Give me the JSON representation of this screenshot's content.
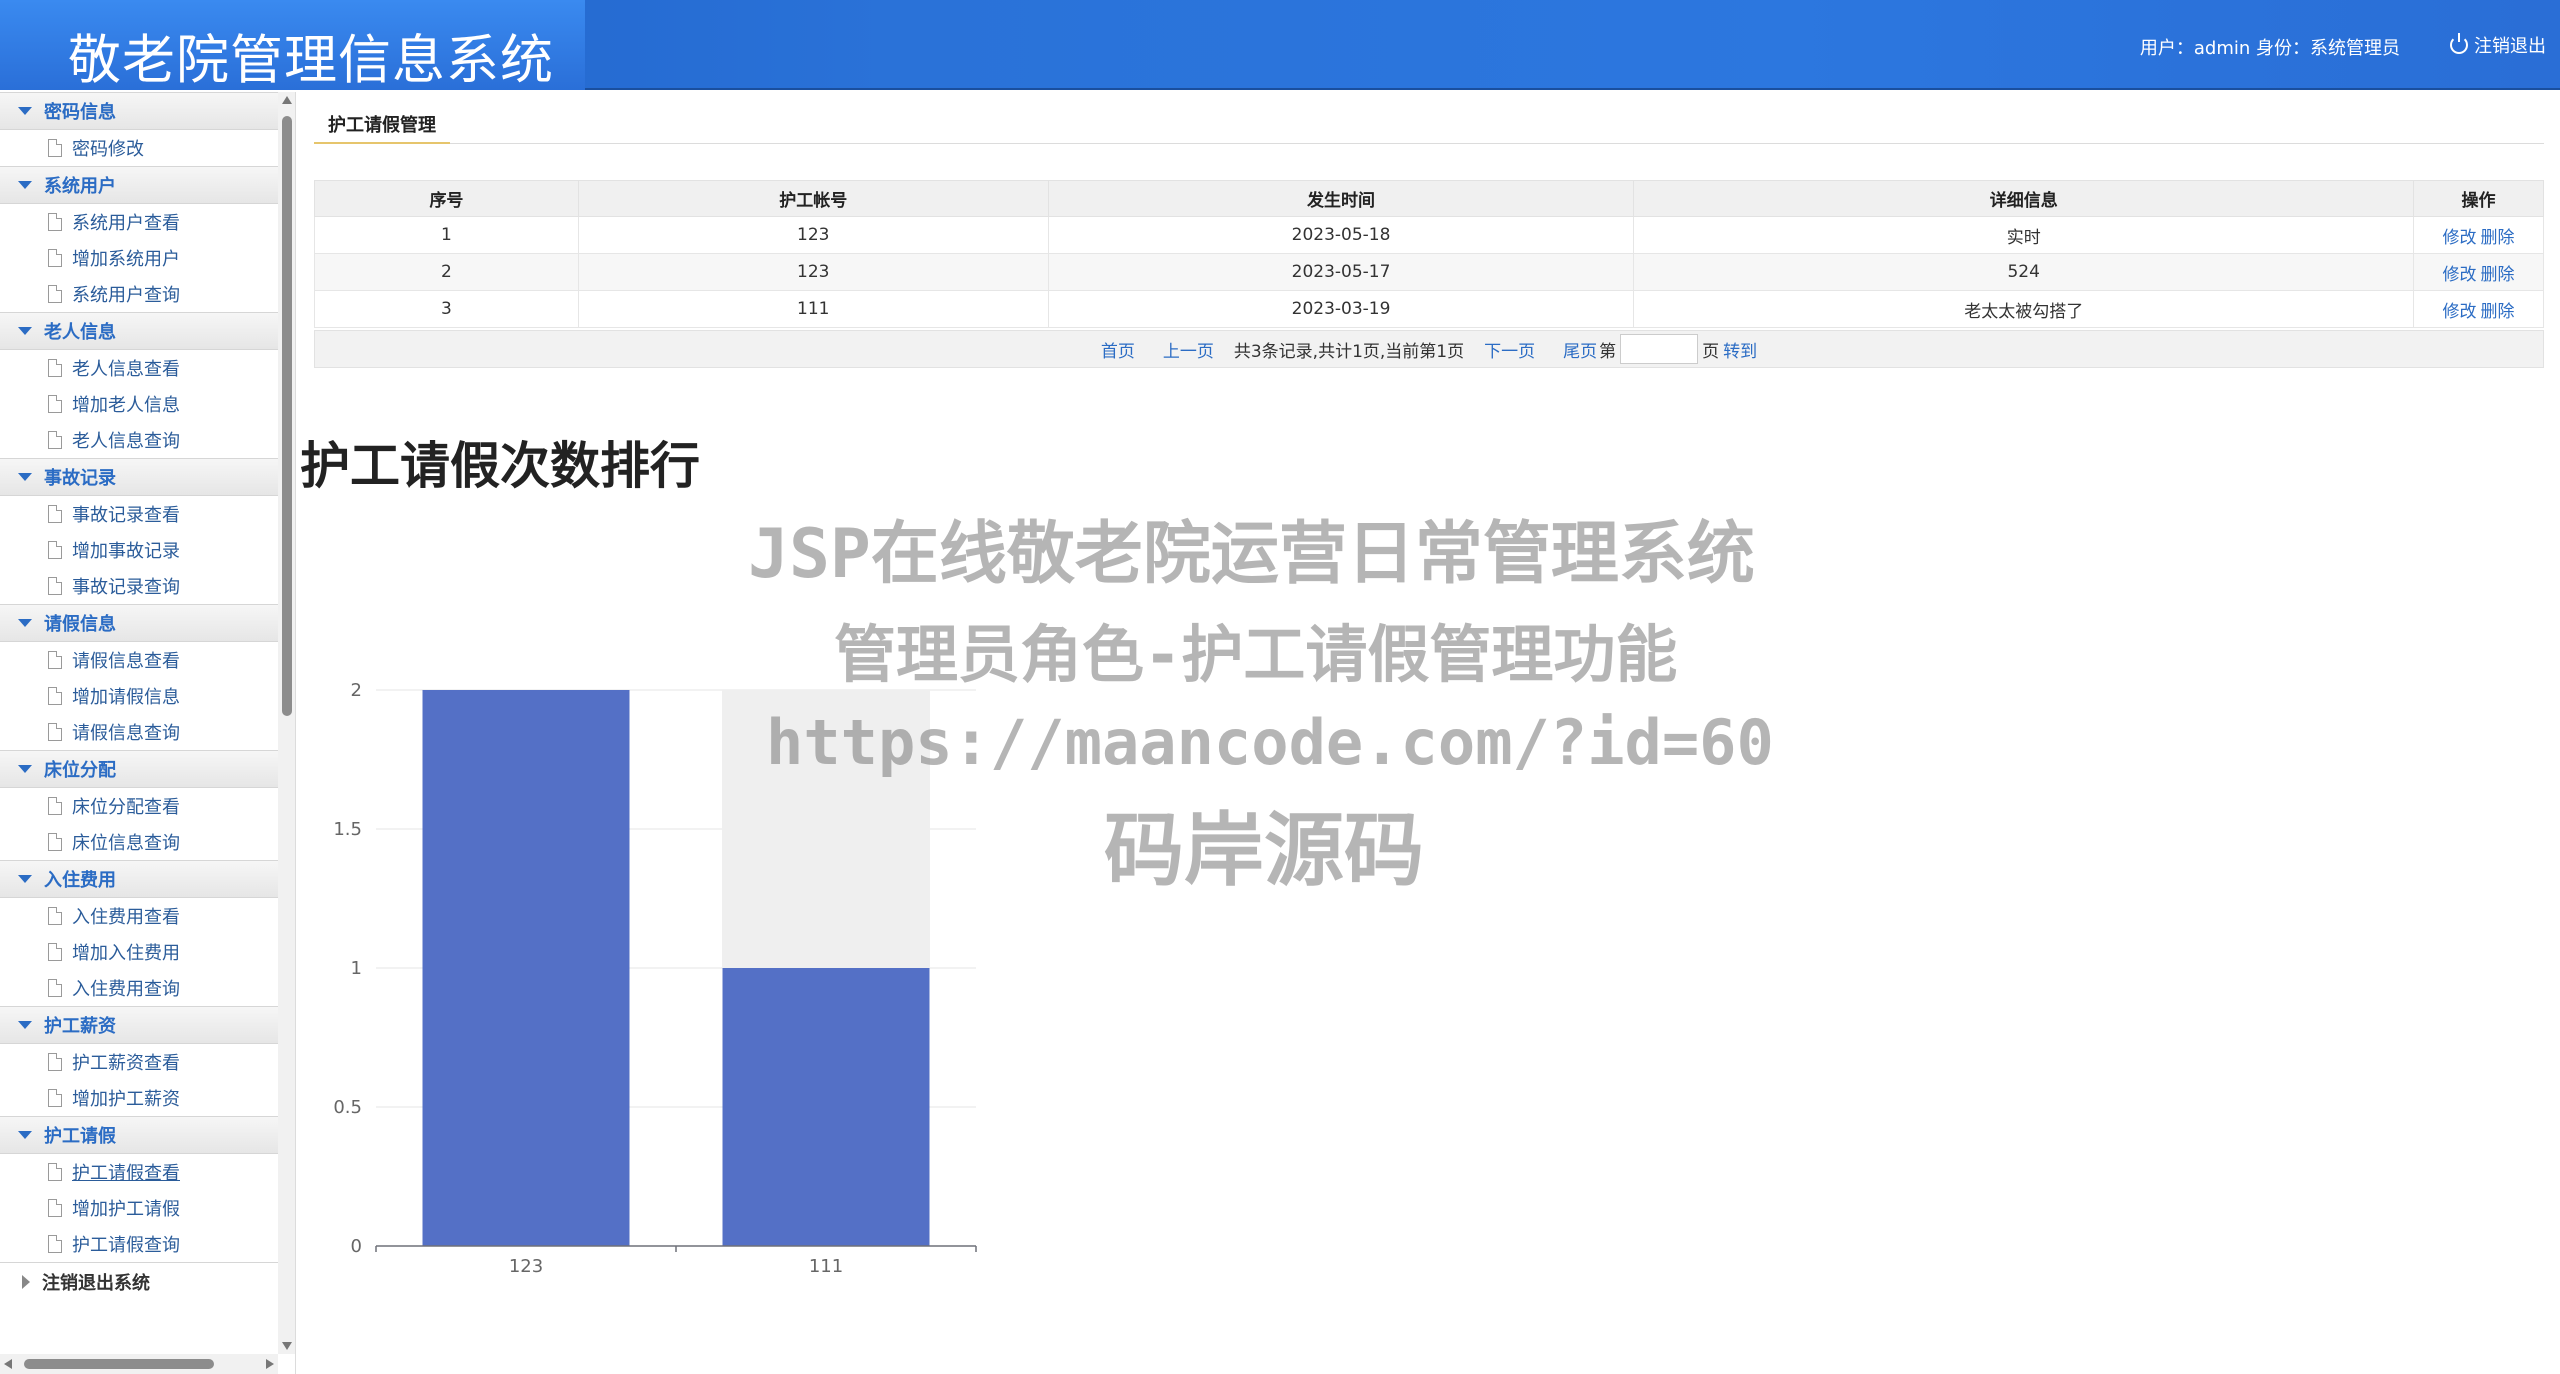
{
  "header": {
    "title": "敬老院管理信息系统",
    "user_info": "用户：admin 身份：系统管理员",
    "logout_label": "注销退出"
  },
  "sidebar": {
    "groups": [
      {
        "label": "密码信息",
        "items": [
          "密码修改"
        ]
      },
      {
        "label": "系统用户",
        "items": [
          "系统用户查看",
          "增加系统用户",
          "系统用户查询"
        ]
      },
      {
        "label": "老人信息",
        "items": [
          "老人信息查看",
          "增加老人信息",
          "老人信息查询"
        ]
      },
      {
        "label": "事故记录",
        "items": [
          "事故记录查看",
          "增加事故记录",
          "事故记录查询"
        ]
      },
      {
        "label": "请假信息",
        "items": [
          "请假信息查看",
          "增加请假信息",
          "请假信息查询"
        ]
      },
      {
        "label": "床位分配",
        "items": [
          "床位分配查看",
          "床位信息查询"
        ]
      },
      {
        "label": "入住费用",
        "items": [
          "入住费用查看",
          "增加入住费用",
          "入住费用查询"
        ]
      },
      {
        "label": "护工薪资",
        "items": [
          "护工薪资查看",
          "增加护工薪资"
        ]
      },
      {
        "label": "护工请假",
        "items": [
          "护工请假查看",
          "增加护工请假",
          "护工请假查询"
        ]
      }
    ],
    "exit_label": "注销退出系统"
  },
  "main": {
    "tab_label": "护工请假管理",
    "table": {
      "columns": [
        "序号",
        "护工帐号",
        "发生时间",
        "详细信息",
        "操作"
      ],
      "rows": [
        {
          "no": "1",
          "account": "123",
          "date": "2023-05-18",
          "detail": "实时"
        },
        {
          "no": "2",
          "account": "123",
          "date": "2023-05-17",
          "detail": "524"
        },
        {
          "no": "3",
          "account": "111",
          "date": "2023-03-19",
          "detail": "老太太被勾搭了"
        }
      ],
      "edit_label": "修改",
      "delete_label": "删除"
    },
    "pager": {
      "first": "首页",
      "prev": "上一页",
      "info": "共3条记录,共计1页,当前第1页",
      "next": "下一页",
      "last": "尾页",
      "page_prefix": "第",
      "page_suffix": "页",
      "goto": "转到"
    },
    "chart_title": "护工请假次数排行"
  },
  "chart_data": {
    "type": "bar",
    "categories": [
      "123",
      "111"
    ],
    "values": [
      2,
      1
    ],
    "ylim": [
      0,
      2
    ],
    "yticks": [
      "0",
      "0.5",
      "1",
      "1.5",
      "2"
    ],
    "bar_color": "#5470c6",
    "grid": true
  },
  "watermark": {
    "line1": "JSP在线敬老院运营日常管理系统",
    "line2": "管理员角色-护工请假管理功能",
    "line3": "https://maancode.com/?id=60",
    "line4": "码岸源码"
  }
}
